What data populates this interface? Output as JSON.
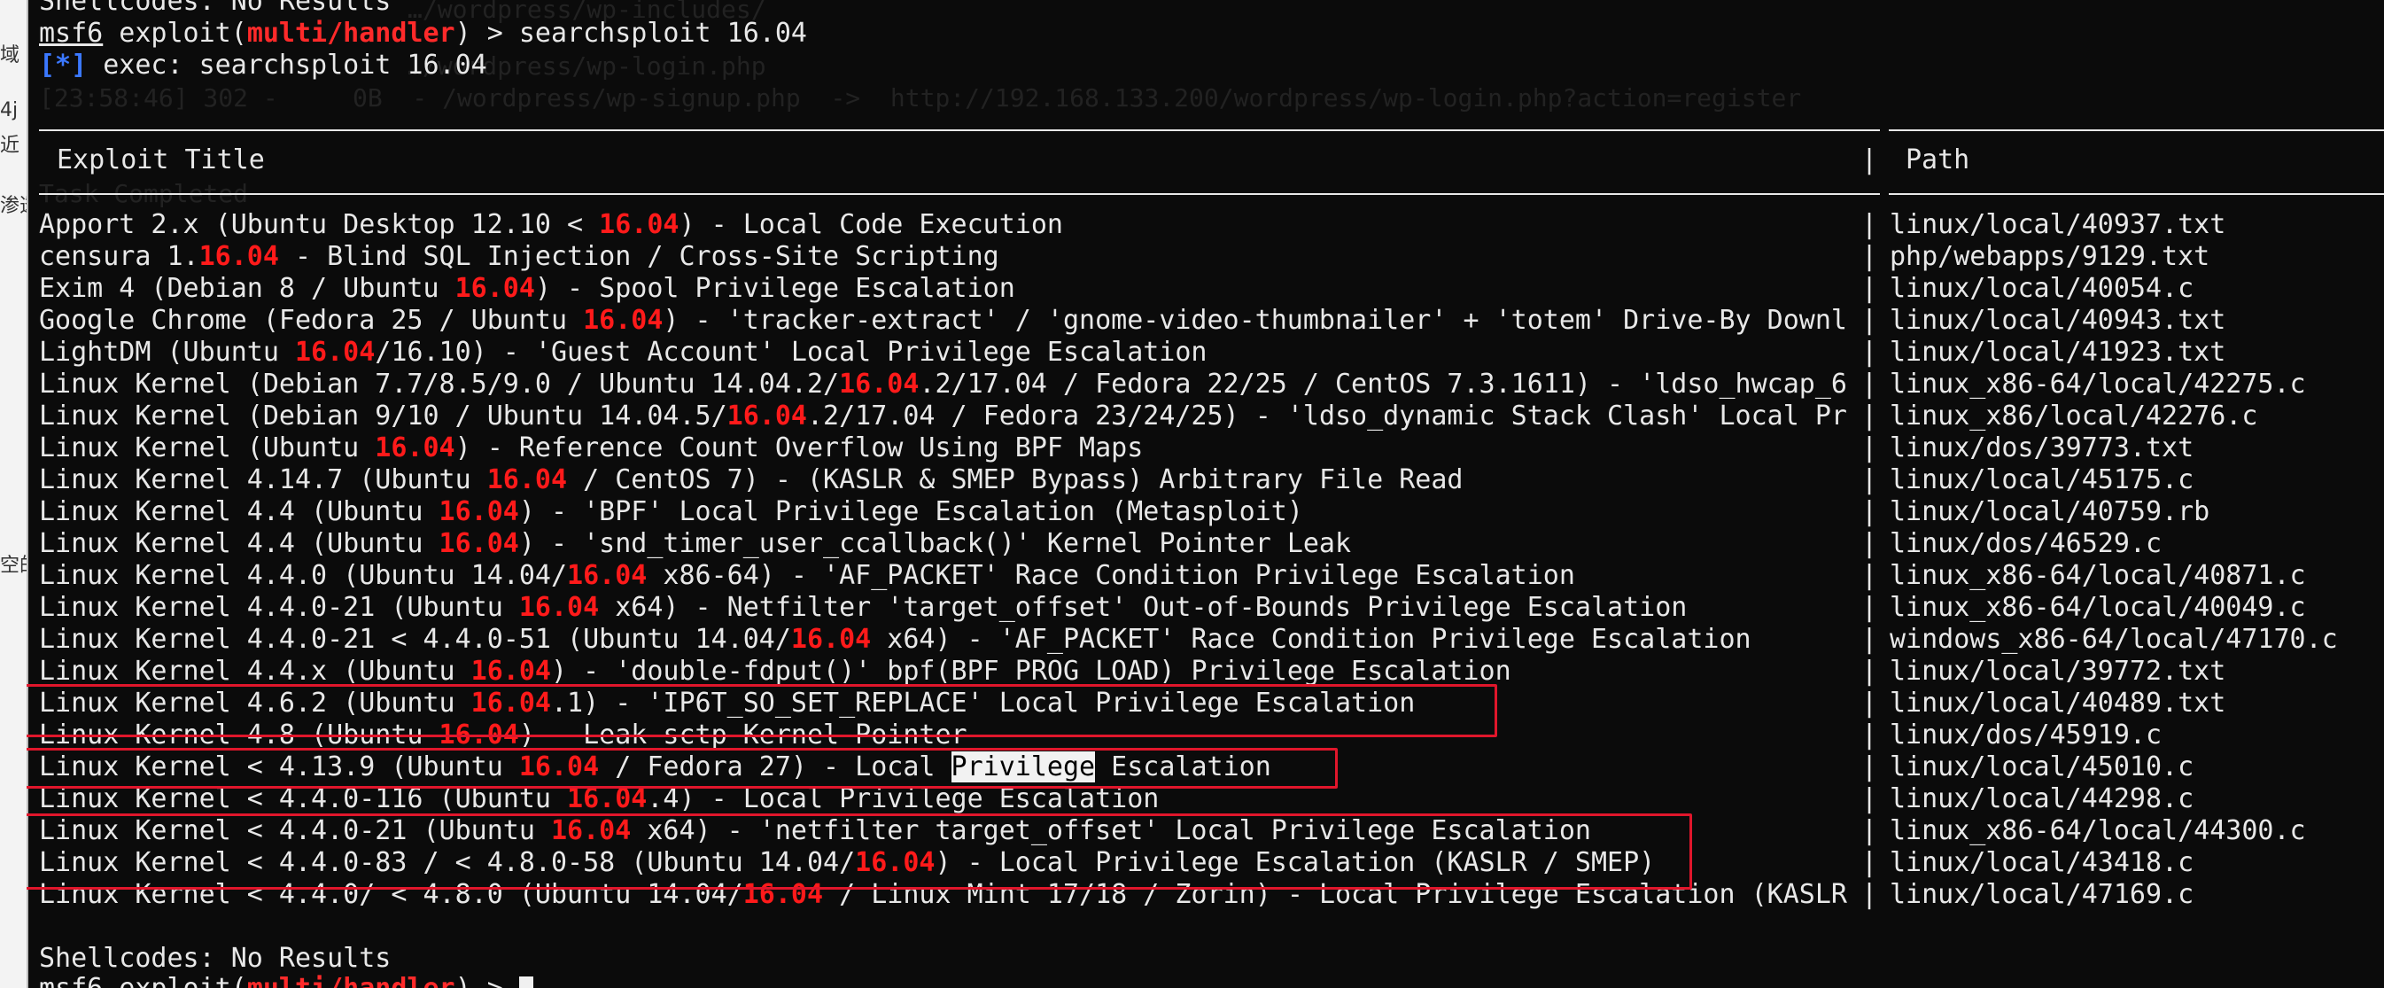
{
  "sidebar_chars": [
    "域",
    "4j",
    "近",
    "渗透",
    "空的"
  ],
  "ghost_text": [
    "…/wordpress/wp-includes/",
    "…/wordpress/wp-login.php",
    "[23:58:46] 302 -     0B  - /wordpress/wp-signup.php  ->  http://192.168.133.200/wordpress/wp-login.php?action=register",
    "Task Completed"
  ],
  "top": {
    "partial_top": "Shellcodes: No Results",
    "prompt_msf": "msf6",
    "prompt_mid": " exploit(",
    "prompt_module": "multi/handler",
    "prompt_end": ") > ",
    "command": "searchsploit 16.04",
    "exec_star": "[*]",
    "exec_text": " exec: searchsploit 16.04"
  },
  "header": {
    "title": "Exploit Title",
    "path": "Path"
  },
  "rows": [
    {
      "p": [
        "Apport 2.x (Ubuntu Desktop 12.10 < ",
        "16.04",
        ") - Local Code Execution"
      ],
      "path": "linux/local/40937.txt"
    },
    {
      "p": [
        "censura 1.",
        "16.04",
        " - Blind SQL Injection / Cross-Site Scripting"
      ],
      "path": "php/webapps/9129.txt"
    },
    {
      "p": [
        "Exim 4 (Debian 8 / Ubuntu ",
        "16.04",
        ") - Spool Privilege Escalation"
      ],
      "path": "linux/local/40054.c"
    },
    {
      "p": [
        "Google Chrome (Fedora 25 / Ubuntu ",
        "16.04",
        ") - 'tracker-extract' / 'gnome-video-thumbnailer' + 'totem' Drive-By Downl"
      ],
      "path": "linux/local/40943.txt"
    },
    {
      "p": [
        "LightDM (Ubuntu ",
        "16.04",
        "/16.10) - 'Guest Account' Local Privilege Escalation"
      ],
      "path": "linux/local/41923.txt"
    },
    {
      "p": [
        "Linux Kernel (Debian 7.7/8.5/9.0 / Ubuntu 14.04.2/",
        "16.04",
        ".2/17.04 / Fedora 22/25 / CentOS 7.3.1611) - 'ldso_hwcap_6"
      ],
      "path": "linux_x86-64/local/42275.c"
    },
    {
      "p": [
        "Linux Kernel (Debian 9/10 / Ubuntu 14.04.5/",
        "16.04",
        ".2/17.04 / Fedora 23/24/25) - 'ldso_dynamic Stack Clash' Local Pr"
      ],
      "path": "linux_x86/local/42276.c"
    },
    {
      "p": [
        "Linux Kernel (Ubuntu ",
        "16.04",
        ") - Reference Count Overflow Using BPF Maps"
      ],
      "path": "linux/dos/39773.txt"
    },
    {
      "p": [
        "Linux Kernel 4.14.7 (Ubuntu ",
        "16.04",
        " / CentOS 7) - (KASLR & SMEP Bypass) Arbitrary File Read"
      ],
      "path": "linux/local/45175.c"
    },
    {
      "p": [
        "Linux Kernel 4.4 (Ubuntu ",
        "16.04",
        ") - 'BPF' Local Privilege Escalation (Metasploit)"
      ],
      "path": "linux/local/40759.rb"
    },
    {
      "p": [
        "Linux Kernel 4.4 (Ubuntu ",
        "16.04",
        ") - 'snd_timer_user_ccallback()' Kernel Pointer Leak"
      ],
      "path": "linux/dos/46529.c"
    },
    {
      "p": [
        "Linux Kernel 4.4.0 (Ubuntu 14.04/",
        "16.04",
        " x86-64) - 'AF_PACKET' Race Condition Privilege Escalation"
      ],
      "path": "linux_x86-64/local/40871.c"
    },
    {
      "p": [
        "Linux Kernel 4.4.0-21 (Ubuntu ",
        "16.04",
        " x64) - Netfilter 'target_offset' Out-of-Bounds Privilege Escalation"
      ],
      "path": "linux_x86-64/local/40049.c"
    },
    {
      "p": [
        "Linux Kernel 4.4.0-21 < 4.4.0-51 (Ubuntu 14.04/",
        "16.04",
        " x64) - 'AF_PACKET' Race Condition Privilege Escalation"
      ],
      "path": "windows_x86-64/local/47170.c"
    },
    {
      "p": [
        "Linux Kernel 4.4.x (Ubuntu ",
        "16.04",
        ") - 'double-fdput()' bpf(BPF_PROG_LOAD) Privilege Escalation"
      ],
      "path": "linux/local/39772.txt"
    },
    {
      "p": [
        "Linux Kernel 4.6.2 (Ubuntu ",
        "16.04",
        ".1) - 'IP6T_SO_SET_REPLACE' Local Privilege Escalation"
      ],
      "path": "linux/local/40489.txt"
    },
    {
      "p": [
        "Linux Kernel 4.8 (Ubuntu ",
        "16.04",
        ") - Leak sctp Kernel Pointer"
      ],
      "path": "linux/dos/45919.c"
    },
    {
      "p": [
        "Linux Kernel < 4.13.9 (Ubuntu ",
        "16.04",
        " / Fedora 27) - Local ",
        "Privilege",
        " Escalation"
      ],
      "path": "linux/local/45010.c"
    },
    {
      "p": [
        "Linux Kernel < 4.4.0-116 (Ubuntu ",
        "16.04",
        ".4) - Local Privilege Escalation"
      ],
      "path": "linux/local/44298.c"
    },
    {
      "p": [
        "Linux Kernel < 4.4.0-21 (Ubuntu ",
        "16.04",
        " x64) - 'netfilter target_offset' Local Privilege Escalation"
      ],
      "path": "linux_x86-64/local/44300.c"
    },
    {
      "p": [
        "Linux Kernel < 4.4.0-83 / < 4.8.0-58 (Ubuntu 14.04/",
        "16.04",
        ") - Local Privilege Escalation (KASLR / SMEP)"
      ],
      "path": "linux/local/43418.c"
    },
    {
      "p": [
        "Linux Kernel < 4.4.0/ < 4.8.0 (Ubuntu 14.04/",
        "16.04",
        " / Linux Mint 17/18 / Zorin) - Local Privilege Escalation (KASLR"
      ],
      "path": "linux/local/47169.c"
    }
  ],
  "footer": {
    "shellcodes": "Shellcodes: No Results",
    "prompt_msf": "msf6",
    "prompt_mid": " exploit(",
    "prompt_module": "multi/handler",
    "prompt_end": ") > "
  },
  "colors": {
    "background": "#0b0b0b",
    "text": "#e8e8e8",
    "highlight": "#ff1a1a",
    "info": "#3b78ff",
    "box": "#e0162b"
  }
}
